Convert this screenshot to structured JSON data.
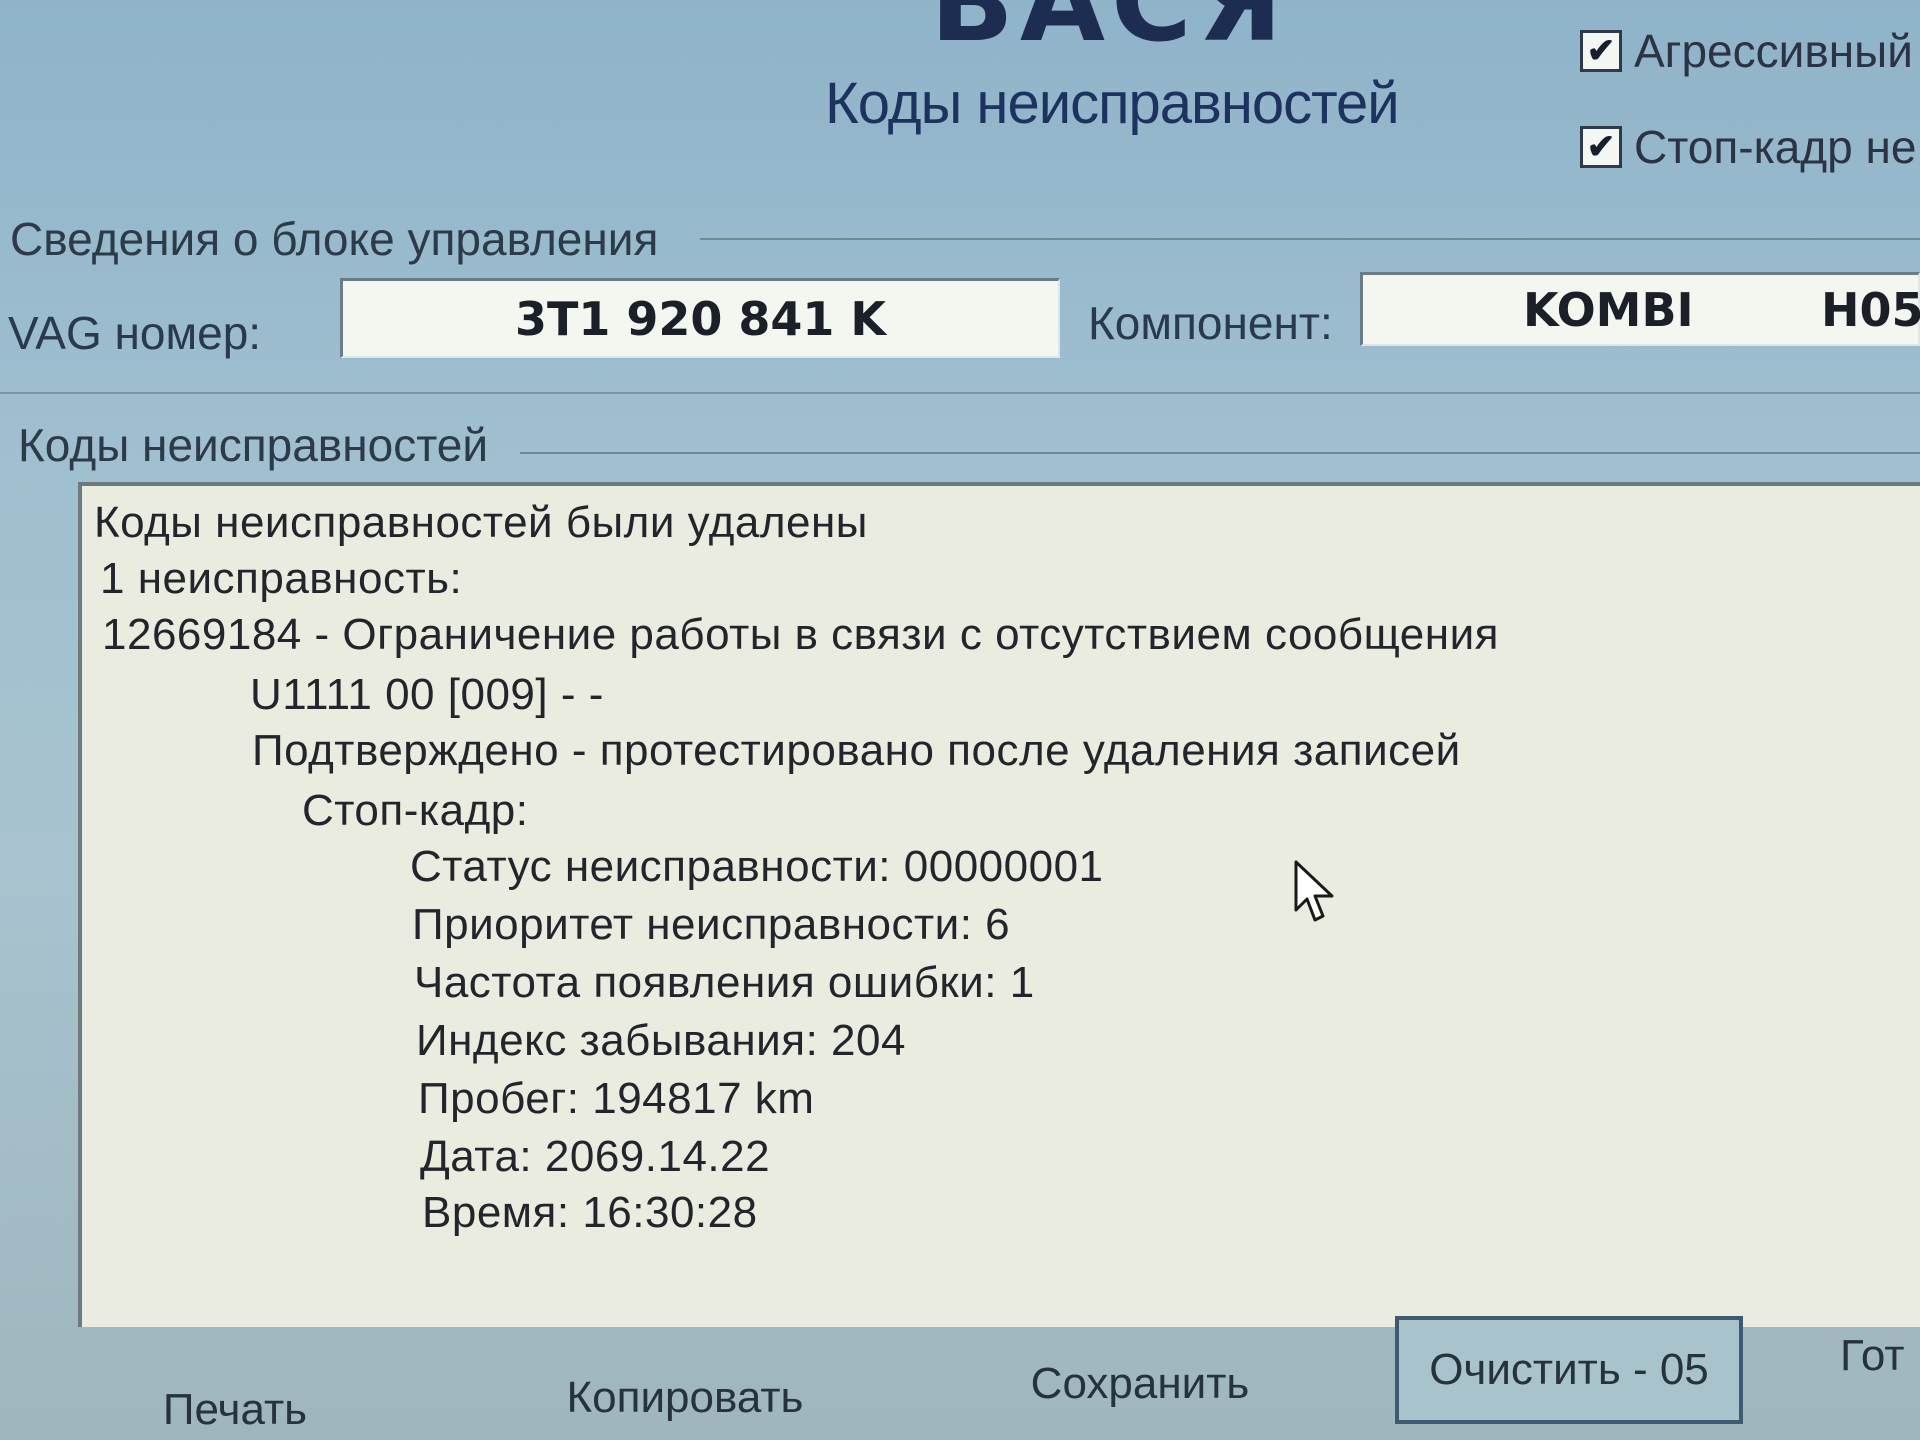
{
  "header": {
    "logo_text": "ВАСЯ",
    "dialog_title": "Коды неисправностей"
  },
  "options": {
    "aggressive": {
      "label": "Агрессивный",
      "checked": true
    },
    "freeze_frame": {
      "label": "Стоп-кадр не",
      "checked": true
    }
  },
  "control_unit": {
    "group_label": "Сведения о блоке управления",
    "vag_label": "VAG номер:",
    "vag_value": "3T1 920 841 K",
    "component_label": "Компонент:",
    "component_name": "KOMBI",
    "component_version": "H05"
  },
  "faults": {
    "group_label": "Коды неисправностей",
    "lines": [
      "Коды неисправностей были удалены",
      "1 неисправность:",
      "12669184 - Ограничение работы в связи с отсутствием сообщения",
      "U1111 00 [009] - -",
      "Подтверждено - протестировано после удаления записей",
      "Стоп-кадр:",
      "Статус неисправности: 00000001",
      "Приоритет неисправности: 6",
      "Частота появления ошибки: 1",
      "Индекс забывания: 204",
      "Пробег: 194817 km",
      "Дата: 2069.14.22",
      "Время: 16:30:28"
    ]
  },
  "buttons": {
    "print": "Печать",
    "copy": "Копировать",
    "save": "Сохранить",
    "clear": "Очистить - 05",
    "done": "Гот"
  },
  "icons": {
    "checkmark": "check-icon",
    "cursor": "mouse-cursor-icon"
  }
}
